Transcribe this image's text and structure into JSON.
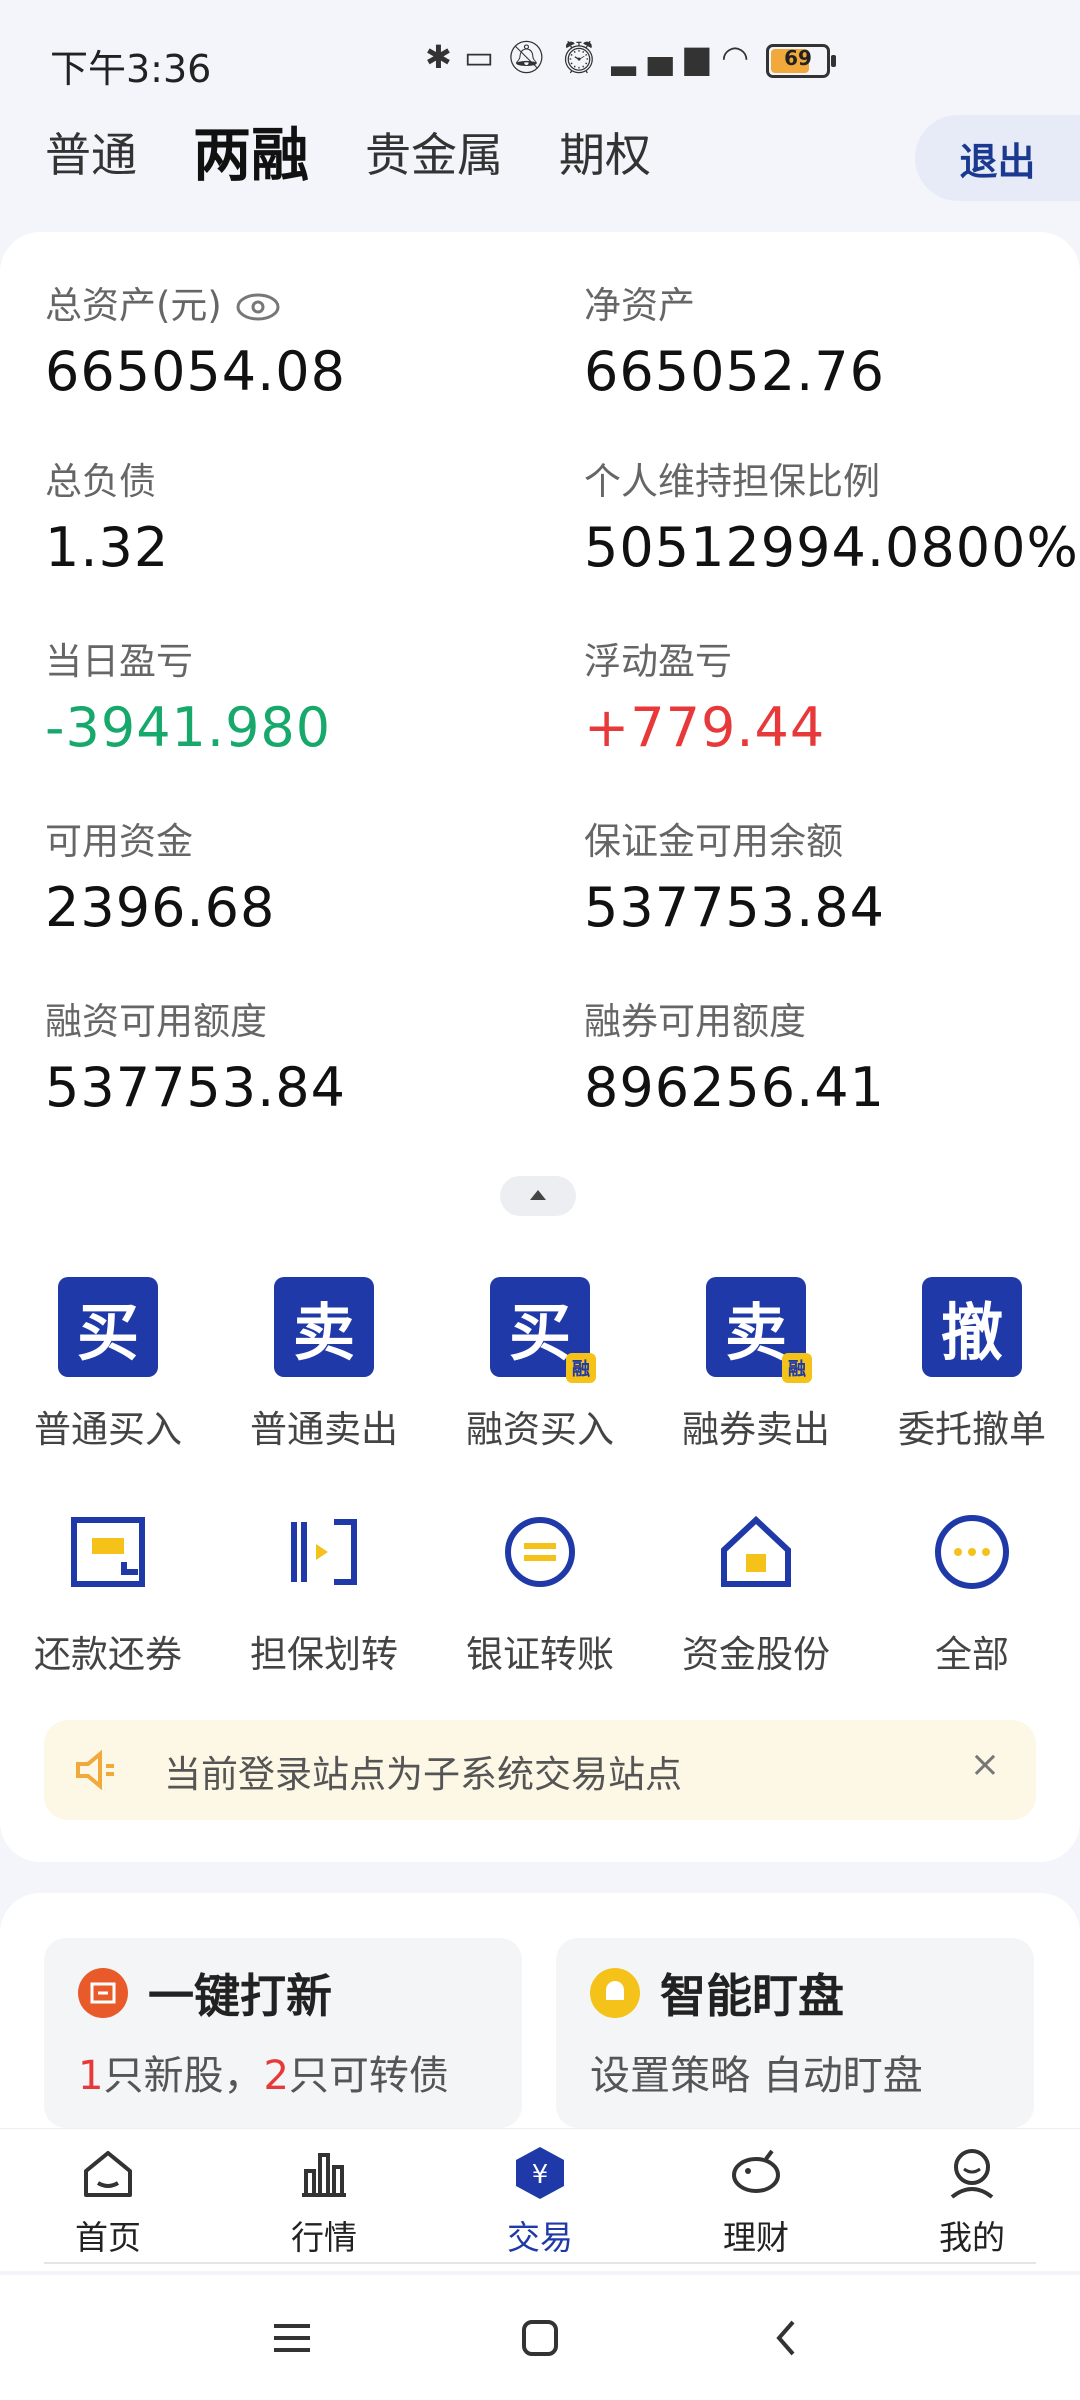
{
  "status_bar": {
    "time": "下午3:36",
    "battery": "69",
    "icons": [
      "bluetooth-icon",
      "vibrate-icon",
      "mute-icon",
      "alarm-icon",
      "signal-icon",
      "wifi-icon",
      "battery-icon"
    ]
  },
  "tabs": [
    {
      "label": "普通",
      "active": false
    },
    {
      "label": "两融",
      "active": true
    },
    {
      "label": "贵金属",
      "active": false
    },
    {
      "label": "期权",
      "active": false
    }
  ],
  "logout_label": "退出",
  "metrics": {
    "total_assets": {
      "label": "总资产(元)",
      "value": "665054.08"
    },
    "net_assets": {
      "label": "净资产",
      "value": "665052.76"
    },
    "total_liabilities": {
      "label": "总负债",
      "value": "1.32"
    },
    "maintenance_ratio": {
      "label": "个人维持担保比例",
      "value": "50512994.0800%"
    },
    "daily_pnl": {
      "label": "当日盈亏",
      "value": "-3941.980"
    },
    "floating_pnl": {
      "label": "浮动盈亏",
      "value": "+779.44"
    },
    "available_funds": {
      "label": "可用资金",
      "value": "2396.68"
    },
    "margin_available": {
      "label": "保证金可用余额",
      "value": "537753.84"
    },
    "financing_limit": {
      "label": "融资可用额度",
      "value": "537753.84"
    },
    "securities_lending_limit": {
      "label": "融券可用额度",
      "value": "896256.41"
    }
  },
  "trade_actions": [
    {
      "icon_char": "买",
      "badge": "",
      "label": "普通买入"
    },
    {
      "icon_char": "卖",
      "badge": "",
      "label": "普通卖出"
    },
    {
      "icon_char": "买",
      "badge": "融",
      "label": "融资买入"
    },
    {
      "icon_char": "卖",
      "badge": "融",
      "label": "融券卖出"
    },
    {
      "icon_char": "撤",
      "badge": "",
      "label": "委托撤单"
    }
  ],
  "tool_actions": [
    {
      "icon": "repay-icon",
      "label": "还款还券"
    },
    {
      "icon": "transfer-collateral-icon",
      "label": "担保划转"
    },
    {
      "icon": "bank-transfer-icon",
      "label": "银证转账"
    },
    {
      "icon": "funds-shares-icon",
      "label": "资金股份"
    },
    {
      "icon": "more-icon",
      "label": "全部"
    }
  ],
  "notice": {
    "text": "当前登录站点为子系统交易站点",
    "close": "×"
  },
  "promos": {
    "ipo": {
      "title": "一键打新",
      "count1": "1",
      "text1": "只新股，",
      "count2": "2",
      "text2": "只可转债"
    },
    "watch": {
      "title": "智能盯盘",
      "subtitle": "设置策略 自动盯盘"
    }
  },
  "bottom_nav": [
    {
      "label": "首页",
      "active": false
    },
    {
      "label": "行情",
      "active": false
    },
    {
      "label": "交易",
      "active": true
    },
    {
      "label": "理财",
      "active": false
    },
    {
      "label": "我的",
      "active": false
    }
  ],
  "colors": {
    "accent": "#1f3aa8",
    "negative": "#17a86b",
    "positive": "#e8393a",
    "warning": "#f5c21a"
  }
}
